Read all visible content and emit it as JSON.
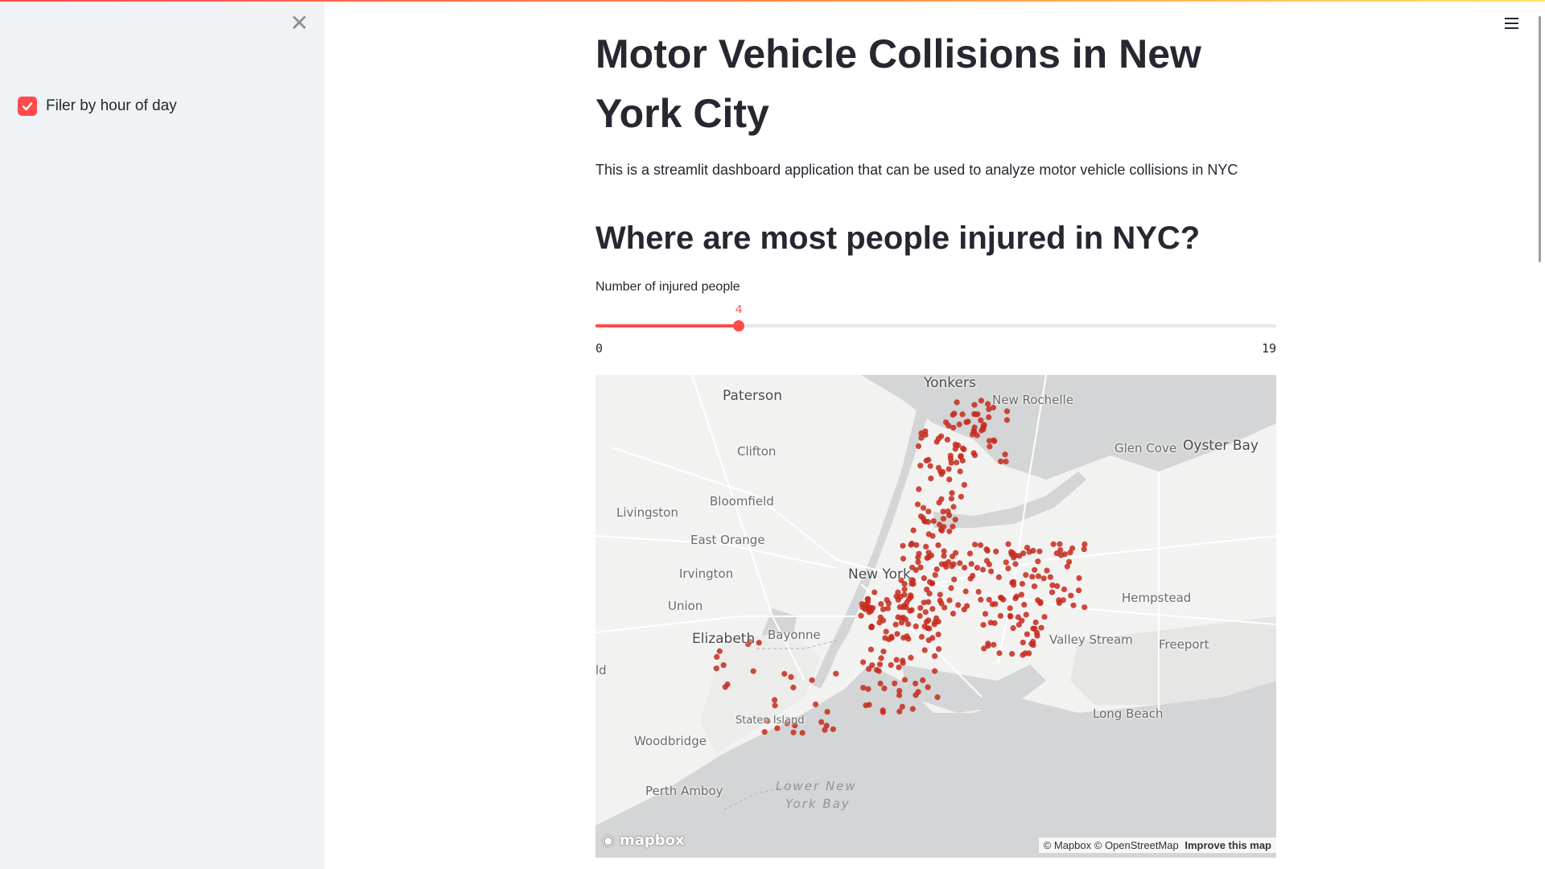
{
  "sidebar": {
    "close_icon": "close-icon",
    "filter_checkbox": {
      "label": "Filer by hour of day",
      "checked": true
    }
  },
  "header": {
    "menu_icon": "hamburger-menu-icon"
  },
  "main": {
    "title": "Motor Vehicle Collisions in New York City",
    "intro": "This is a streamlit dashboard application that can be used to analyze motor vehicle collisions in NYC",
    "subheader": "Where are most people injured in NYC?",
    "slider": {
      "label": "Number of injured people",
      "value": 4,
      "min": 0,
      "max": 19,
      "min_label": "0",
      "max_label": "19",
      "value_label": "4"
    }
  },
  "map": {
    "places": [
      {
        "name": "Yonkers",
        "class": "big"
      },
      {
        "name": "Paterson",
        "class": "big"
      },
      {
        "name": "New Rochelle",
        "class": ""
      },
      {
        "name": "Clifton",
        "class": ""
      },
      {
        "name": "Glen Cove",
        "class": ""
      },
      {
        "name": "Oyster Bay",
        "class": "big"
      },
      {
        "name": "Bloomfield",
        "class": ""
      },
      {
        "name": "Livingston",
        "class": ""
      },
      {
        "name": "East Orange",
        "class": ""
      },
      {
        "name": "Irvington",
        "class": ""
      },
      {
        "name": "New York",
        "class": "big"
      },
      {
        "name": "Hempstead",
        "class": ""
      },
      {
        "name": "Union",
        "class": ""
      },
      {
        "name": "Elizabeth",
        "class": "big"
      },
      {
        "name": "Bayonne",
        "class": ""
      },
      {
        "name": "Valley Stream",
        "class": ""
      },
      {
        "name": "Freeport",
        "class": ""
      },
      {
        "name": "Staten Island",
        "class": ""
      },
      {
        "name": "Long Beach",
        "class": ""
      },
      {
        "name": "Woodbridge",
        "class": ""
      },
      {
        "name": "Perth Amboy",
        "class": ""
      },
      {
        "name": "Lower New",
        "class": "water"
      },
      {
        "name": "York Bay",
        "class": "water"
      },
      {
        "name": "ld",
        "class": ""
      }
    ],
    "logo": "mapbox",
    "attribution": "© Mapbox © OpenStreetMap",
    "improve_link": "Improve this map",
    "point_color": "#c62a1c"
  }
}
